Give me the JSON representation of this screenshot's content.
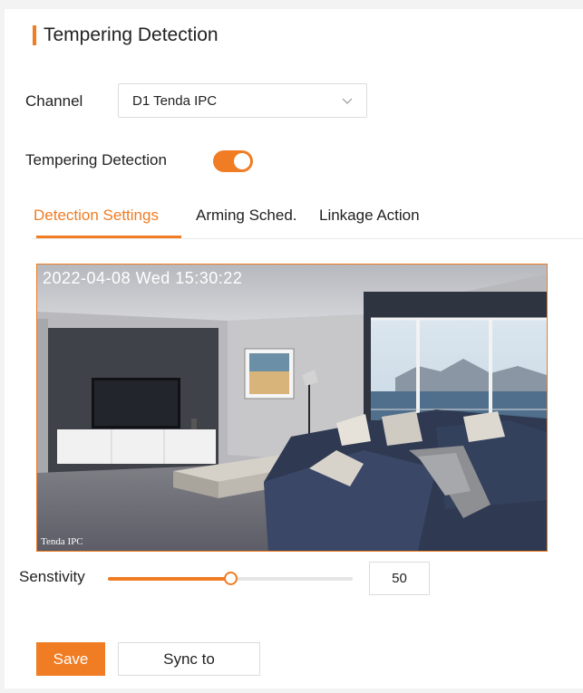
{
  "header": {
    "title": "Tempering Detection"
  },
  "channel": {
    "label": "Channel",
    "selected": "D1 Tenda IPC",
    "icon": "chevron-down-icon"
  },
  "detection_toggle": {
    "label": "Tempering Detection",
    "enabled": true
  },
  "tabs": [
    {
      "label": "Detection Settings",
      "active": true
    },
    {
      "label": "Arming Sched.",
      "active": false
    },
    {
      "label": "Linkage Action",
      "active": false
    }
  ],
  "video": {
    "timestamp": "2022-04-08  Wed  15:30:22",
    "watermark": "Tenda  IPC"
  },
  "sensitivity": {
    "label": "Senstivity",
    "value": "50",
    "fraction": 0.5
  },
  "actions": {
    "save_label": "Save",
    "sync_label": "Sync to"
  },
  "colors": {
    "accent": "#f07c23",
    "border": "#dcdcdc"
  }
}
